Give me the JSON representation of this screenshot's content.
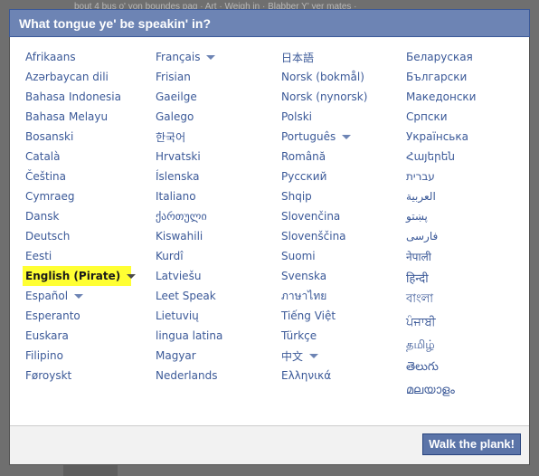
{
  "background": {
    "ghost_text": "bout 4 bus o' yon boundes pag · Art · Weigh in · Blabber Y' yer mates ·"
  },
  "dialog": {
    "title": "What tongue ye' be speakin' in?",
    "button_label": "Walk the plank!"
  },
  "languages": {
    "col1": [
      {
        "label": "Afrikaans"
      },
      {
        "label": "Azərbaycan dili"
      },
      {
        "label": "Bahasa Indonesia"
      },
      {
        "label": "Bahasa Melayu"
      },
      {
        "label": "Bosanski"
      },
      {
        "label": "Català"
      },
      {
        "label": "Čeština"
      },
      {
        "label": "Cymraeg"
      },
      {
        "label": "Dansk"
      },
      {
        "label": "Deutsch"
      },
      {
        "label": "Eesti"
      },
      {
        "label": "English (Pirate)",
        "selected": true,
        "dropdown": true
      },
      {
        "label": "Español",
        "dropdown": true
      },
      {
        "label": "Esperanto"
      },
      {
        "label": "Euskara"
      },
      {
        "label": "Filipino"
      },
      {
        "label": "Føroyskt"
      }
    ],
    "col2": [
      {
        "label": "Français",
        "dropdown": true
      },
      {
        "label": "Frisian"
      },
      {
        "label": "Gaeilge"
      },
      {
        "label": "Galego"
      },
      {
        "label": "한국어"
      },
      {
        "label": "Hrvatski"
      },
      {
        "label": "Íslenska"
      },
      {
        "label": "Italiano"
      },
      {
        "label": "ქართული"
      },
      {
        "label": "Kiswahili"
      },
      {
        "label": "Kurdî"
      },
      {
        "label": "Latviešu"
      },
      {
        "label": "Leet Speak"
      },
      {
        "label": "Lietuvių"
      },
      {
        "label": "lingua latina"
      },
      {
        "label": "Magyar"
      },
      {
        "label": "Nederlands"
      }
    ],
    "col3": [
      {
        "label": "日本語"
      },
      {
        "label": "Norsk (bokmål)"
      },
      {
        "label": "Norsk (nynorsk)"
      },
      {
        "label": "Polski"
      },
      {
        "label": "Português",
        "dropdown": true
      },
      {
        "label": "Română"
      },
      {
        "label": "Русский"
      },
      {
        "label": "Shqip"
      },
      {
        "label": "Slovenčina"
      },
      {
        "label": "Slovenščina"
      },
      {
        "label": "Suomi"
      },
      {
        "label": "Svenska"
      },
      {
        "label": "ภาษาไทย"
      },
      {
        "label": "Tiếng Việt"
      },
      {
        "label": "Türkçe"
      },
      {
        "label": "中文",
        "dropdown": true
      },
      {
        "label": "Ελληνικά"
      }
    ],
    "col4": [
      {
        "label": "Беларуская"
      },
      {
        "label": "Български"
      },
      {
        "label": "Македонски"
      },
      {
        "label": "Српски"
      },
      {
        "label": "Українська"
      },
      {
        "label": "Հայերեն"
      },
      {
        "label": "עברית"
      },
      {
        "label": "العربية"
      },
      {
        "label": "پښتو"
      },
      {
        "label": "فارسی"
      },
      {
        "label": "नेपाली"
      },
      {
        "label": "हिन्दी",
        "big": true
      },
      {
        "label": "বাংলা",
        "big": true
      },
      {
        "label": "ਪੰਜਾਬੀ",
        "big": true
      },
      {
        "label": "தமிழ்",
        "big": true
      },
      {
        "label": "తెలుగు",
        "big": true
      },
      {
        "label": "മലയാളം",
        "big": true
      }
    ]
  },
  "colors": {
    "header": "#6d84b4",
    "link": "#3b5998",
    "highlight": "#ffff33",
    "button": "#5b74a8"
  }
}
